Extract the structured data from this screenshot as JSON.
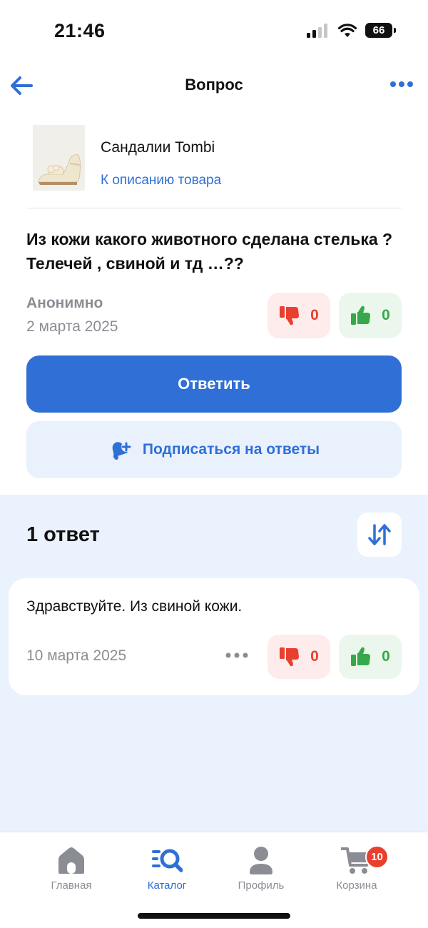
{
  "status_bar": {
    "time": "21:46",
    "battery": "66",
    "icons": [
      "signal-icon",
      "wifi-icon",
      "battery-icon"
    ]
  },
  "header": {
    "title": "Вопрос",
    "back_icon": "arrow-left-icon",
    "more_icon": "more-dots-icon"
  },
  "product": {
    "name": "Сандалии Tombi",
    "link": "К описанию товара",
    "thumb_icon": "sandal-image"
  },
  "question": {
    "text": "Из кожи какого животного сделана стелька ? Телечей , свиной и тд …??",
    "author": "Анонимно",
    "date": "2 марта 2025",
    "dislikes": "0",
    "likes": "0"
  },
  "actions": {
    "reply_label": "Ответить",
    "subscribe_label": "Подписаться на ответы",
    "subscribe_icon": "bell-plus-icon"
  },
  "answers": {
    "count_label": "1 ответ",
    "sort_icon": "sort-arrows-icon",
    "items": [
      {
        "text": "Здравствуйте. Из свиной кожи.",
        "date": "10 марта 2025",
        "dislikes": "0",
        "likes": "0"
      }
    ]
  },
  "tab_bar": {
    "items": [
      {
        "label": "Главная",
        "icon": "home-icon",
        "active": false
      },
      {
        "label": "Каталог",
        "icon": "catalog-search-icon",
        "active": true
      },
      {
        "label": "Профиль",
        "icon": "profile-icon",
        "active": false
      },
      {
        "label": "Корзина",
        "icon": "cart-icon",
        "active": false,
        "badge": "10"
      }
    ]
  },
  "colors": {
    "accent": "#2f6fd6",
    "dislike": "#e8402f",
    "like": "#36a84a",
    "answers_background": "#eaf2fd"
  }
}
